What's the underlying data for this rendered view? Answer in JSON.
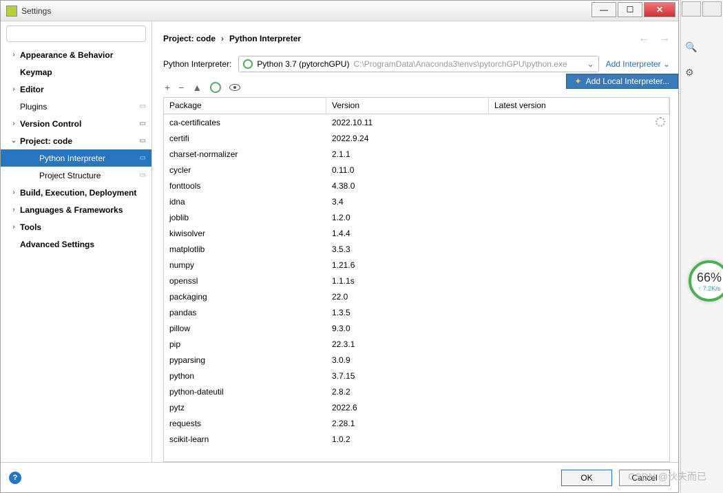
{
  "title": "Settings",
  "search_placeholder": "",
  "sidebar": {
    "items": [
      {
        "label": "Appearance & Behavior",
        "bold": true,
        "chev": ">"
      },
      {
        "label": "Keymap",
        "bold": true,
        "chev": ""
      },
      {
        "label": "Editor",
        "bold": true,
        "chev": ">"
      },
      {
        "label": "Plugins",
        "bold": false,
        "chev": "",
        "marker": "▭"
      },
      {
        "label": "Version Control",
        "bold": true,
        "chev": ">",
        "marker": "▭"
      },
      {
        "label": "Project: code",
        "bold": true,
        "chev": "v",
        "marker": "▭"
      },
      {
        "label": "Python Interpreter",
        "bold": false,
        "chev": "",
        "child": true,
        "selected": true,
        "marker": "▭"
      },
      {
        "label": "Project Structure",
        "bold": false,
        "chev": "",
        "child": true,
        "marker": "▭"
      },
      {
        "label": "Build, Execution, Deployment",
        "bold": true,
        "chev": ">"
      },
      {
        "label": "Languages & Frameworks",
        "bold": true,
        "chev": ">"
      },
      {
        "label": "Tools",
        "bold": true,
        "chev": ">"
      },
      {
        "label": "Advanced Settings",
        "bold": true,
        "chev": ""
      }
    ]
  },
  "crumb": {
    "a": "Project: code",
    "sep": "›",
    "b": "Python Interpreter"
  },
  "interp": {
    "label": "Python Interpreter:",
    "name": "Python 3.7 (pytorchGPU)",
    "path": "C:\\ProgramData\\Anaconda3\\envs\\pytorchGPU\\python.exe",
    "add": "Add Interpreter",
    "popup": "Add Local Interpreter..."
  },
  "columns": {
    "p": "Package",
    "v": "Version",
    "l": "Latest version"
  },
  "packages": [
    {
      "p": "ca-certificates",
      "v": "2022.10.11"
    },
    {
      "p": "certifi",
      "v": "2022.9.24"
    },
    {
      "p": "charset-normalizer",
      "v": "2.1.1"
    },
    {
      "p": "cycler",
      "v": "0.11.0"
    },
    {
      "p": "fonttools",
      "v": "4.38.0"
    },
    {
      "p": "idna",
      "v": "3.4"
    },
    {
      "p": "joblib",
      "v": "1.2.0"
    },
    {
      "p": "kiwisolver",
      "v": "1.4.4"
    },
    {
      "p": "matplotlib",
      "v": "3.5.3"
    },
    {
      "p": "numpy",
      "v": "1.21.6"
    },
    {
      "p": "openssl",
      "v": "1.1.1s"
    },
    {
      "p": "packaging",
      "v": "22.0"
    },
    {
      "p": "pandas",
      "v": "1.3.5"
    },
    {
      "p": "pillow",
      "v": "9.3.0"
    },
    {
      "p": "pip",
      "v": "22.3.1"
    },
    {
      "p": "pyparsing",
      "v": "3.0.9"
    },
    {
      "p": "python",
      "v": "3.7.15"
    },
    {
      "p": "python-dateutil",
      "v": "2.8.2"
    },
    {
      "p": "pytz",
      "v": "2022.6"
    },
    {
      "p": "requests",
      "v": "2.28.1"
    },
    {
      "p": "scikit-learn",
      "v": "1.0.2"
    }
  ],
  "buttons": {
    "ok": "OK",
    "cancel": "Cancel"
  },
  "gauge": {
    "pct": "66%",
    "sub": "↑ 7.2K/s"
  },
  "watermark": "CSDN @伙夫而已"
}
